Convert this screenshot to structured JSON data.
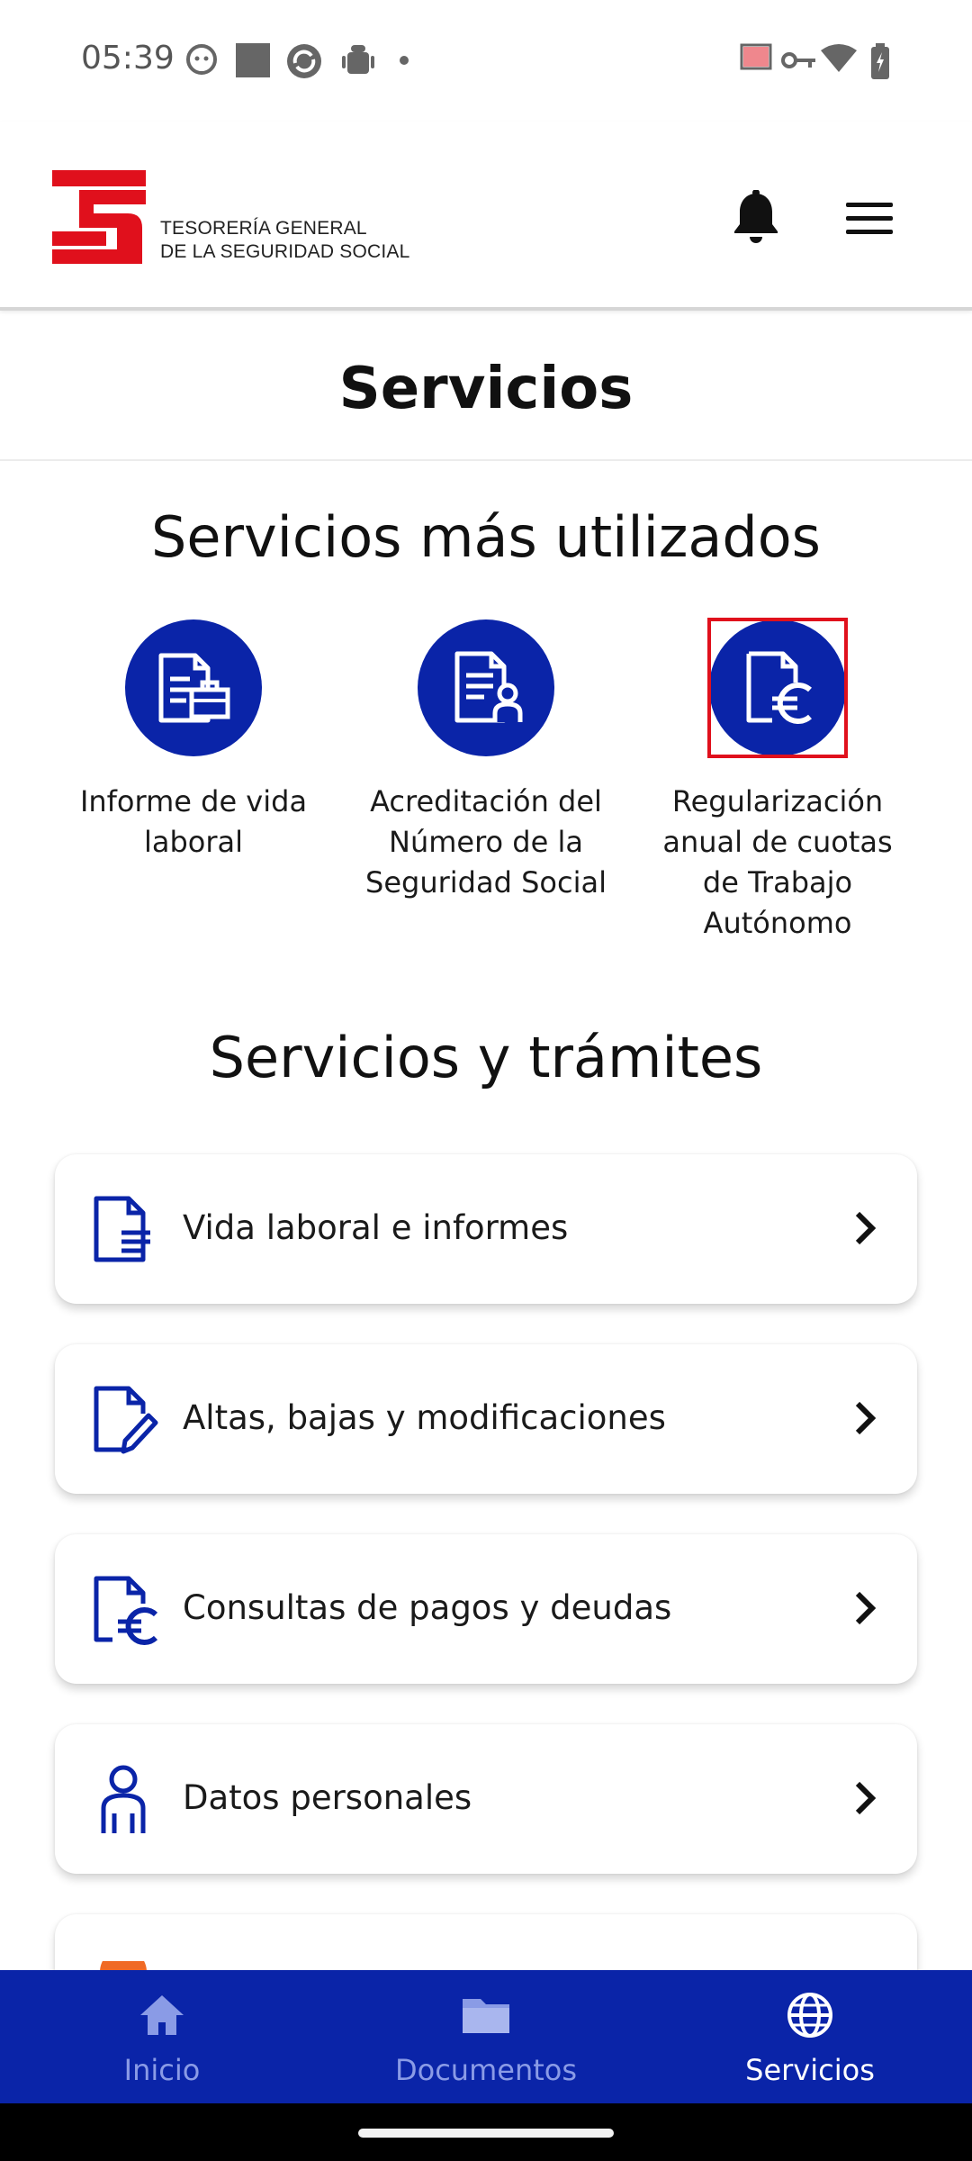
{
  "status_bar": {
    "time": "05:39"
  },
  "header": {
    "logo_line1": "TESORERÍA GENERAL",
    "logo_line2": "DE LA SEGURIDAD SOCIAL",
    "brand_color": "#e0101c"
  },
  "page": {
    "title": "Servicios"
  },
  "most_used": {
    "title": "Servicios más utilizados",
    "items": [
      {
        "label": "Informe de vida laboral",
        "icon": "document-briefcase-icon"
      },
      {
        "label": "Acreditación del Número de la Seguridad Social",
        "icon": "document-person-icon"
      },
      {
        "label": "Regularización anual de cuotas de Trabajo Autónomo",
        "icon": "document-euro-icon"
      }
    ]
  },
  "services": {
    "title": "Servicios y trámites",
    "items": [
      {
        "label": "Vida laboral e informes",
        "icon": "document-lines-icon"
      },
      {
        "label": "Altas, bajas y modificaciones",
        "icon": "document-pencil-icon"
      },
      {
        "label": "Consultas de pagos y deudas",
        "icon": "document-euro-icon"
      },
      {
        "label": "Datos personales",
        "icon": "person-icon"
      }
    ]
  },
  "bottom_nav": {
    "items": [
      {
        "label": "Inicio",
        "icon": "home-icon",
        "active": false
      },
      {
        "label": "Documentos",
        "icon": "folder-icon",
        "active": false
      },
      {
        "label": "Servicios",
        "icon": "globe-icon",
        "active": true
      }
    ]
  },
  "colors": {
    "primary": "#0a24a8",
    "highlight": "#e0101c"
  }
}
